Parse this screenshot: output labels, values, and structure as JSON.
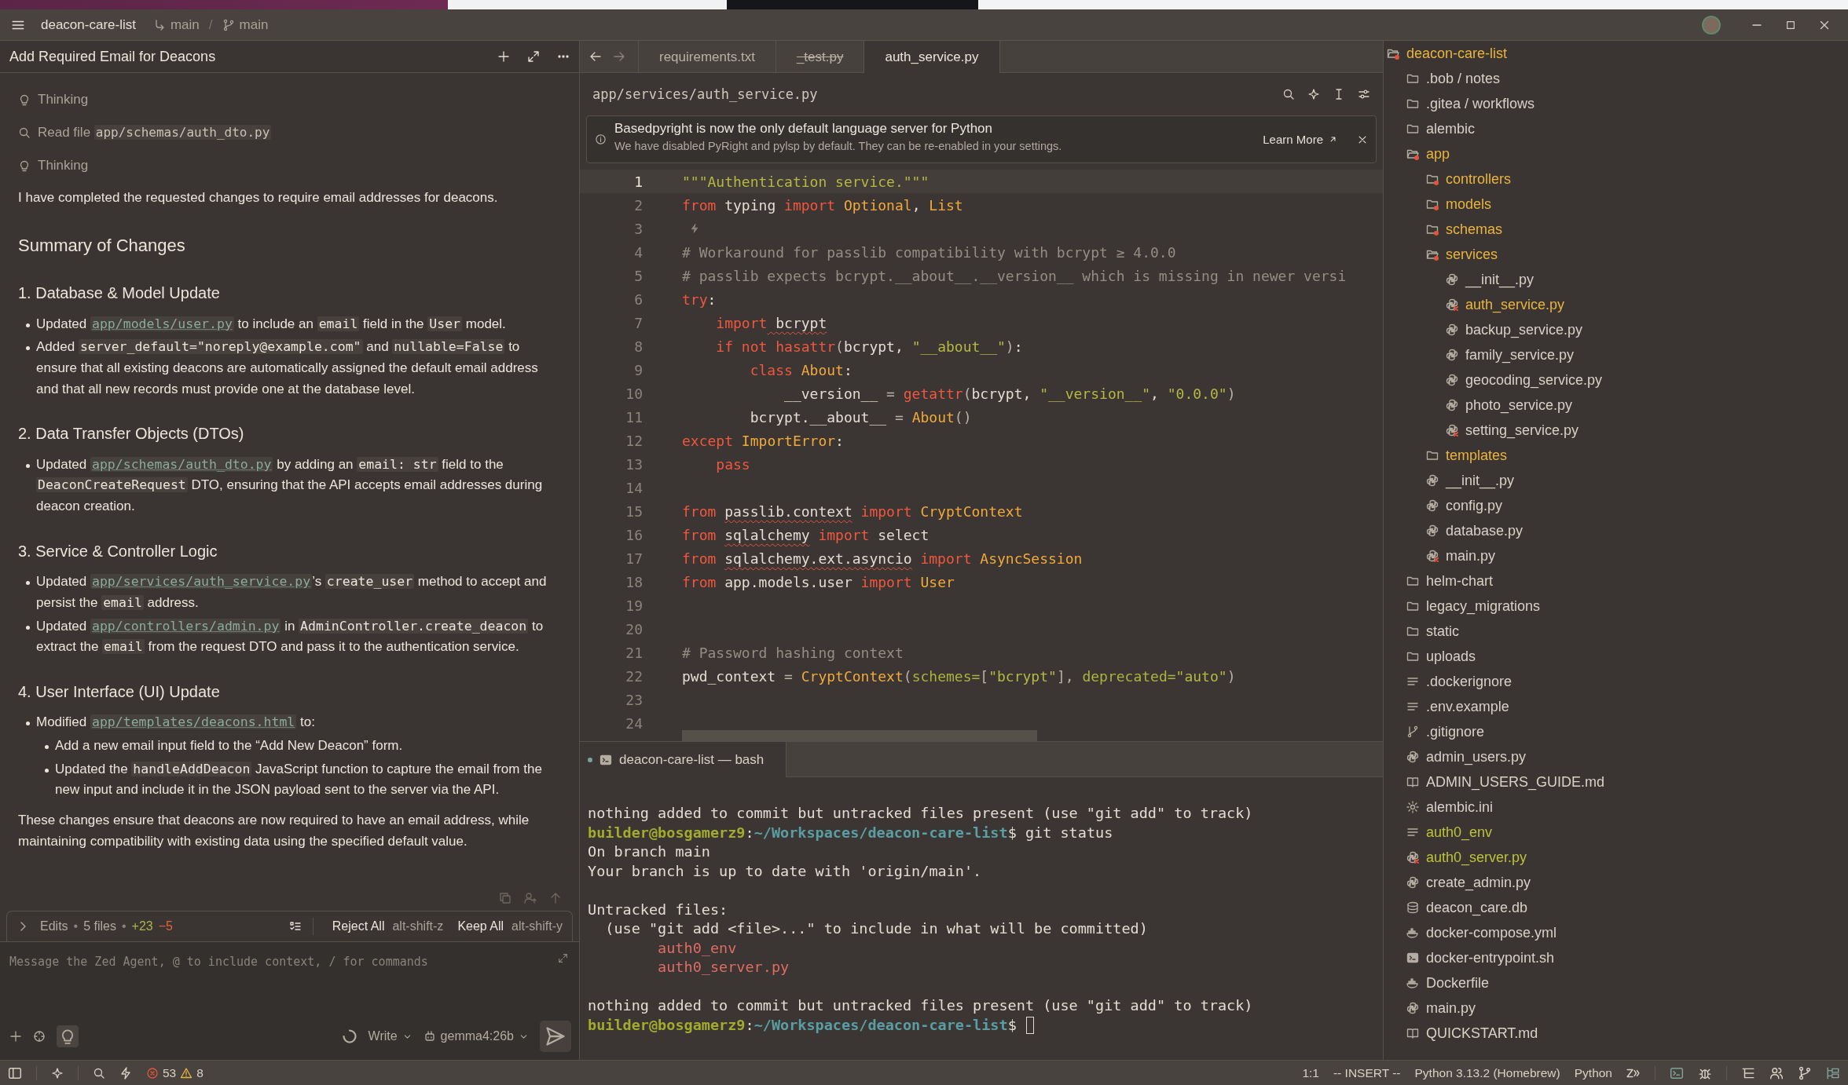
{
  "title_bar": {
    "project": "deacon-care-list",
    "worktree": "main",
    "separator": "/",
    "branch": "main"
  },
  "agent_panel": {
    "title": "Add Required Email for Deacons",
    "activity": [
      {
        "kind": "thinking",
        "label": "Thinking"
      },
      {
        "kind": "read",
        "label": "Read file ",
        "path": "app/schemas/auth_dto.py"
      },
      {
        "kind": "thinking",
        "label": "Thinking"
      }
    ],
    "message": [
      {
        "kind": "paragraph",
        "segments": [
          {
            "kind": "text",
            "text": "I have completed the requested changes to require email addresses for deacons."
          }
        ]
      },
      {
        "kind": "heading",
        "text": "Summary of Changes"
      },
      {
        "kind": "subheading",
        "text": "1. Database & Model Update"
      },
      {
        "kind": "bullets",
        "items": [
          {
            "segments": [
              {
                "kind": "text",
                "text": "Updated "
              },
              {
                "kind": "link",
                "text": "app/models/user.py"
              },
              {
                "kind": "text",
                "text": " to include an "
              },
              {
                "kind": "code",
                "text": "email"
              },
              {
                "kind": "text",
                "text": " field in the "
              },
              {
                "kind": "code",
                "text": "User"
              },
              {
                "kind": "text",
                "text": " model."
              }
            ]
          },
          {
            "segments": [
              {
                "kind": "text",
                "text": "Added "
              },
              {
                "kind": "code",
                "text": "server_default=\"noreply@example.com\""
              },
              {
                "kind": "text",
                "text": " and "
              },
              {
                "kind": "code",
                "text": "nullable=False"
              },
              {
                "kind": "text",
                "text": " to ensure that all existing deacons are automatically assigned the default email address and that all new records must provide one at the database level."
              }
            ]
          }
        ]
      },
      {
        "kind": "subheading",
        "text": "2. Data Transfer Objects (DTOs)"
      },
      {
        "kind": "bullets",
        "items": [
          {
            "segments": [
              {
                "kind": "text",
                "text": "Updated "
              },
              {
                "kind": "link",
                "text": "app/schemas/auth_dto.py"
              },
              {
                "kind": "text",
                "text": " by adding an "
              },
              {
                "kind": "code",
                "text": "email: str"
              },
              {
                "kind": "text",
                "text": " field to the "
              },
              {
                "kind": "code",
                "text": "DeaconCreateRequest"
              },
              {
                "kind": "text",
                "text": " DTO, ensuring that the API accepts email addresses during deacon creation."
              }
            ]
          }
        ]
      },
      {
        "kind": "subheading",
        "text": "3. Service & Controller Logic"
      },
      {
        "kind": "bullets",
        "items": [
          {
            "segments": [
              {
                "kind": "text",
                "text": "Updated "
              },
              {
                "kind": "link",
                "text": "app/services/auth_service.py"
              },
              {
                "kind": "text",
                "text": "’s "
              },
              {
                "kind": "code",
                "text": "create_user"
              },
              {
                "kind": "text",
                "text": " method to accept and persist the "
              },
              {
                "kind": "code",
                "text": "email"
              },
              {
                "kind": "text",
                "text": " address."
              }
            ]
          },
          {
            "segments": [
              {
                "kind": "text",
                "text": "Updated "
              },
              {
                "kind": "link",
                "text": "app/controllers/admin.py"
              },
              {
                "kind": "text",
                "text": " in "
              },
              {
                "kind": "code",
                "text": "AdminController.create_deacon"
              },
              {
                "kind": "text",
                "text": " to extract the "
              },
              {
                "kind": "code",
                "text": "email"
              },
              {
                "kind": "text",
                "text": " from the request DTO and pass it to the authentication service."
              }
            ]
          }
        ]
      },
      {
        "kind": "subheading",
        "text": "4. User Interface (UI) Update"
      },
      {
        "kind": "bullets",
        "items": [
          {
            "segments": [
              {
                "kind": "text",
                "text": "Modified "
              },
              {
                "kind": "link",
                "text": "app/templates/deacons.html"
              },
              {
                "kind": "text",
                "text": " to:"
              }
            ],
            "children": [
              {
                "segments": [
                  {
                    "kind": "text",
                    "text": "Add a new email input field to the “Add New Deacon” form."
                  }
                ]
              },
              {
                "segments": [
                  {
                    "kind": "text",
                    "text": "Updated the "
                  },
                  {
                    "kind": "code",
                    "text": "handleAddDeacon"
                  },
                  {
                    "kind": "text",
                    "text": " JavaScript function to capture the email from the new input and include it in the JSON payload sent to the server via the API."
                  }
                ]
              }
            ]
          }
        ]
      },
      {
        "kind": "paragraph",
        "segments": [
          {
            "kind": "text",
            "text": "These changes ensure that deacons are now required to have an email address, while maintaining compatibility with existing data using the specified default value."
          }
        ]
      }
    ],
    "edits": {
      "expanded": false,
      "summary": [
        {
          "kind": "label",
          "text": "Edits"
        },
        {
          "kind": "sep",
          "text": "•"
        },
        {
          "kind": "label",
          "text": "5 files"
        },
        {
          "kind": "sep",
          "text": "•"
        },
        {
          "kind": "added",
          "text": "+23"
        },
        {
          "kind": "removed",
          "text": "−5"
        }
      ],
      "reject": {
        "label": "Reject All",
        "shortcut": "alt-shift-z"
      },
      "keep": {
        "label": "Keep All",
        "shortcut": "alt-shift-y"
      }
    },
    "input": {
      "placeholder": "Message the Zed Agent, @ to include context, / for commands"
    },
    "generating": true,
    "mode": "Write",
    "model": "gemma4:26b"
  },
  "editor": {
    "tabs": [
      {
        "label": "requirements.txt",
        "selected": false,
        "deleted": false
      },
      {
        "label": "_test.py",
        "selected": false,
        "deleted": true
      },
      {
        "label": "auth_service.py",
        "selected": true,
        "deleted": false
      }
    ],
    "path": "app/services/auth_service.py",
    "notice": {
      "title": "Basedpyright is now the only default language server for Python",
      "body": "We have disabled PyRight and pylsp by default. They can be re-enabled in your settings.",
      "action": "Learn More"
    },
    "lines": [
      {
        "n": "1",
        "active": true,
        "tokens": [
          {
            "kind": "str",
            "text": "\"\"\"Authentication service.\"\"\""
          }
        ]
      },
      {
        "n": "2",
        "active": false,
        "tokens": [
          {
            "kind": "kw",
            "text": "from"
          },
          {
            "kind": "plain",
            "text": " typing "
          },
          {
            "kind": "kw",
            "text": "import"
          },
          {
            "kind": "type",
            "text": " Optional"
          },
          {
            "kind": "plain",
            "text": ", "
          },
          {
            "kind": "type",
            "text": "List"
          }
        ]
      },
      {
        "n": "3",
        "active": false,
        "kind": "prediction"
      },
      {
        "n": "4",
        "active": false,
        "tokens": [
          {
            "kind": "cm",
            "text": "# Workaround for passlib compatibility with bcrypt ≥ 4.0.0"
          }
        ]
      },
      {
        "n": "5",
        "active": false,
        "tokens": [
          {
            "kind": "cm",
            "text": "# passlib expects bcrypt.__about__.__version__ which is missing in newer versi"
          }
        ]
      },
      {
        "n": "6",
        "active": false,
        "tokens": [
          {
            "kind": "kw",
            "text": "try"
          },
          {
            "kind": "plain",
            "text": ":"
          }
        ]
      },
      {
        "n": "7",
        "active": false,
        "tokens": [
          {
            "kind": "kw",
            "text": "    import"
          },
          {
            "kind": "bad",
            "text": " bcrypt"
          }
        ]
      },
      {
        "n": "8",
        "active": false,
        "tokens": [
          {
            "kind": "kw",
            "text": "    if not hasattr"
          },
          {
            "kind": "punct",
            "text": "("
          },
          {
            "kind": "plain",
            "text": "bcrypt, "
          },
          {
            "kind": "str",
            "text": "\"__about__\""
          },
          {
            "kind": "punct",
            "text": ")"
          },
          {
            "kind": "plain",
            "text": ":"
          }
        ]
      },
      {
        "n": "9",
        "active": false,
        "tokens": [
          {
            "kind": "kw",
            "text": "        class"
          },
          {
            "kind": "type",
            "text": " About"
          },
          {
            "kind": "plain",
            "text": ":"
          }
        ]
      },
      {
        "n": "10",
        "active": false,
        "tokens": [
          {
            "kind": "plain",
            "text": "            __version__ "
          },
          {
            "kind": "punct",
            "text": "= "
          },
          {
            "kind": "kw",
            "text": "getattr"
          },
          {
            "kind": "punct",
            "text": "("
          },
          {
            "kind": "plain",
            "text": "bcrypt, "
          },
          {
            "kind": "str",
            "text": "\"__version__\""
          },
          {
            "kind": "plain",
            "text": ", "
          },
          {
            "kind": "str",
            "text": "\"0.0.0\""
          },
          {
            "kind": "punct",
            "text": ")"
          }
        ]
      },
      {
        "n": "11",
        "active": false,
        "tokens": [
          {
            "kind": "plain",
            "text": "        bcrypt.__about__ "
          },
          {
            "kind": "punct",
            "text": "= "
          },
          {
            "kind": "type",
            "text": "About"
          },
          {
            "kind": "punct",
            "text": "()"
          }
        ]
      },
      {
        "n": "12",
        "active": false,
        "tokens": [
          {
            "kind": "kw",
            "text": "except"
          },
          {
            "kind": "type",
            "text": " ImportError"
          },
          {
            "kind": "plain",
            "text": ":"
          }
        ]
      },
      {
        "n": "13",
        "active": false,
        "tokens": [
          {
            "kind": "kw",
            "text": "    pass"
          }
        ]
      },
      {
        "n": "14",
        "active": false
      },
      {
        "n": "15",
        "active": false,
        "tokens": [
          {
            "kind": "kw",
            "text": "from "
          },
          {
            "kind": "bad",
            "text": "passlib.context"
          },
          {
            "kind": "kw",
            "text": " import"
          },
          {
            "kind": "type",
            "text": " CryptContext"
          }
        ]
      },
      {
        "n": "16",
        "active": false,
        "tokens": [
          {
            "kind": "kw",
            "text": "from "
          },
          {
            "kind": "bad",
            "text": "sqlalchemy"
          },
          {
            "kind": "kw",
            "text": " import"
          },
          {
            "kind": "plain",
            "text": " select"
          }
        ]
      },
      {
        "n": "17",
        "active": false,
        "tokens": [
          {
            "kind": "kw",
            "text": "from "
          },
          {
            "kind": "bad",
            "text": "sqlalchemy.ext.asyncio"
          },
          {
            "kind": "kw",
            "text": " import"
          },
          {
            "kind": "type",
            "text": " AsyncSession"
          }
        ]
      },
      {
        "n": "18",
        "active": false,
        "tokens": [
          {
            "kind": "kw",
            "text": "from"
          },
          {
            "kind": "plain",
            "text": " app.models.user "
          },
          {
            "kind": "kw",
            "text": "import"
          },
          {
            "kind": "type",
            "text": " User"
          }
        ]
      },
      {
        "n": "19",
        "active": false
      },
      {
        "n": "20",
        "active": false
      },
      {
        "n": "21",
        "active": false,
        "tokens": [
          {
            "kind": "cm",
            "text": "# Password hashing context"
          }
        ]
      },
      {
        "n": "22",
        "active": false,
        "tokens": [
          {
            "kind": "plain",
            "text": "pwd_context "
          },
          {
            "kind": "punct",
            "text": "= "
          },
          {
            "kind": "type",
            "text": "CryptContext"
          },
          {
            "kind": "punct",
            "text": "("
          },
          {
            "kind": "param",
            "text": "schemes="
          },
          {
            "kind": "punct",
            "text": "["
          },
          {
            "kind": "str",
            "text": "\"bcrypt\""
          },
          {
            "kind": "punct",
            "text": "], "
          },
          {
            "kind": "param",
            "text": "deprecated="
          },
          {
            "kind": "str",
            "text": "\"auto\""
          },
          {
            "kind": "punct",
            "text": ")"
          }
        ]
      },
      {
        "n": "23",
        "active": false
      },
      {
        "n": "24",
        "active": false
      }
    ]
  },
  "terminal": {
    "tab": {
      "label": "deacon-care-list — bash",
      "selected": true
    },
    "cursor": true,
    "lines": [
      {
        "kind": "text",
        "segments": [
          {
            "kind": "plain",
            "text": "nothing added to commit but untracked files present (use \"git add\" to track)"
          }
        ]
      },
      {
        "kind": "text",
        "segments": [
          {
            "kind": "user",
            "text": "builder@bosgamerz9"
          },
          {
            "kind": "plain",
            "text": ":"
          },
          {
            "kind": "path",
            "text": "~/Workspaces/deacon-care-list"
          },
          {
            "kind": "plain",
            "text": "$ git status"
          }
        ]
      },
      {
        "kind": "text",
        "segments": [
          {
            "kind": "plain",
            "text": "On branch main"
          }
        ]
      },
      {
        "kind": "text",
        "segments": [
          {
            "kind": "plain",
            "text": "Your branch is up to date with 'origin/main'."
          }
        ]
      },
      {
        "kind": "blank"
      },
      {
        "kind": "text",
        "segments": [
          {
            "kind": "plain",
            "text": "Untracked files:"
          }
        ]
      },
      {
        "kind": "text",
        "segments": [
          {
            "kind": "plain",
            "text": "  (use \"git add <file>...\" to include in what will be committed)"
          }
        ]
      },
      {
        "kind": "text",
        "segments": [
          {
            "kind": "untracked",
            "text": "auth0_env"
          }
        ]
      },
      {
        "kind": "text",
        "segments": [
          {
            "kind": "untracked",
            "text": "auth0_server.py"
          }
        ]
      },
      {
        "kind": "blank"
      },
      {
        "kind": "text",
        "segments": [
          {
            "kind": "plain",
            "text": "nothing added to commit but untracked files present (use \"git add\" to track)"
          }
        ]
      },
      {
        "kind": "prompt",
        "segments": [
          {
            "kind": "user",
            "text": "builder@bosgamerz9"
          },
          {
            "kind": "plain",
            "text": ":"
          },
          {
            "kind": "path",
            "text": "~/Workspaces/deacon-care-list"
          },
          {
            "kind": "plain",
            "text": "$"
          }
        ]
      }
    ]
  },
  "project_tree": {
    "items": [
      {
        "name": "deacon-care-list",
        "kind": "folder",
        "expanded": true,
        "modified": true,
        "untracked": false,
        "has_errors": true,
        "children": [
          {
            "name": ".bob / notes",
            "kind": "folder",
            "expanded": false,
            "modified": false,
            "untracked": false,
            "has_errors": false
          },
          {
            "name": ".gitea / workflows",
            "kind": "folder",
            "expanded": false,
            "modified": false,
            "untracked": false,
            "has_errors": false
          },
          {
            "name": "alembic",
            "kind": "folder",
            "expanded": false,
            "modified": false,
            "untracked": false,
            "has_errors": false
          },
          {
            "name": "app",
            "kind": "folder",
            "expanded": true,
            "modified": true,
            "untracked": false,
            "has_errors": true,
            "children": [
              {
                "name": "controllers",
                "kind": "folder",
                "expanded": false,
                "modified": true,
                "untracked": false,
                "has_errors": true
              },
              {
                "name": "models",
                "kind": "folder",
                "expanded": false,
                "modified": true,
                "untracked": false,
                "has_errors": true
              },
              {
                "name": "schemas",
                "kind": "folder",
                "expanded": false,
                "modified": true,
                "untracked": false,
                "has_errors": true
              },
              {
                "name": "services",
                "kind": "folder",
                "expanded": true,
                "modified": true,
                "untracked": false,
                "has_errors": true,
                "children": [
                  {
                    "name": "__init__.py",
                    "kind": "python",
                    "modified": false,
                    "untracked": false,
                    "has_errors": false
                  },
                  {
                    "name": "auth_service.py",
                    "kind": "python",
                    "modified": true,
                    "untracked": false,
                    "has_errors": true
                  },
                  {
                    "name": "backup_service.py",
                    "kind": "python",
                    "modified": false,
                    "untracked": false,
                    "has_errors": false
                  },
                  {
                    "name": "family_service.py",
                    "kind": "python",
                    "modified": false,
                    "untracked": false,
                    "has_errors": false
                  },
                  {
                    "name": "geocoding_service.py",
                    "kind": "python",
                    "modified": false,
                    "untracked": false,
                    "has_errors": false
                  },
                  {
                    "name": "photo_service.py",
                    "kind": "python",
                    "modified": false,
                    "untracked": false,
                    "has_errors": false
                  },
                  {
                    "name": "setting_service.py",
                    "kind": "python",
                    "modified": false,
                    "untracked": false,
                    "has_errors": true
                  }
                ]
              },
              {
                "name": "templates",
                "kind": "folder",
                "expanded": false,
                "modified": true,
                "untracked": false,
                "has_errors": false
              },
              {
                "name": "__init__.py",
                "kind": "python",
                "modified": false,
                "untracked": false,
                "has_errors": false
              },
              {
                "name": "config.py",
                "kind": "python",
                "modified": false,
                "untracked": false,
                "has_errors": false
              },
              {
                "name": "database.py",
                "kind": "python",
                "modified": false,
                "untracked": false,
                "has_errors": false
              },
              {
                "name": "main.py",
                "kind": "python",
                "modified": false,
                "untracked": false,
                "has_errors": true
              }
            ]
          },
          {
            "name": "helm-chart",
            "kind": "folder",
            "expanded": false,
            "modified": false,
            "untracked": false,
            "has_errors": false
          },
          {
            "name": "legacy_migrations",
            "kind": "folder",
            "expanded": false,
            "modified": false,
            "untracked": false,
            "has_errors": false
          },
          {
            "name": "static",
            "kind": "folder",
            "expanded": false,
            "modified": false,
            "untracked": false,
            "has_errors": false
          },
          {
            "name": "uploads",
            "kind": "folder",
            "expanded": false,
            "modified": false,
            "untracked": false,
            "has_errors": false
          },
          {
            "name": ".dockerignore",
            "kind": "text",
            "modified": false,
            "untracked": false,
            "has_errors": false
          },
          {
            "name": ".env.example",
            "kind": "text",
            "modified": false,
            "untracked": false,
            "has_errors": false
          },
          {
            "name": ".gitignore",
            "kind": "git",
            "modified": false,
            "untracked": false,
            "has_errors": false
          },
          {
            "name": "admin_users.py",
            "kind": "python",
            "modified": false,
            "untracked": false,
            "has_errors": false
          },
          {
            "name": "ADMIN_USERS_GUIDE.md",
            "kind": "markdown",
            "modified": false,
            "untracked": false,
            "has_errors": false
          },
          {
            "name": "alembic.ini",
            "kind": "config",
            "modified": false,
            "untracked": false,
            "has_errors": false
          },
          {
            "name": "auth0_env",
            "kind": "text",
            "modified": false,
            "untracked": true,
            "has_errors": false
          },
          {
            "name": "auth0_server.py",
            "kind": "python",
            "modified": false,
            "untracked": true,
            "has_errors": true
          },
          {
            "name": "create_admin.py",
            "kind": "python",
            "modified": false,
            "untracked": false,
            "has_errors": false
          },
          {
            "name": "deacon_care.db",
            "kind": "database",
            "modified": false,
            "untracked": false,
            "has_errors": false
          },
          {
            "name": "docker-compose.yml",
            "kind": "docker",
            "modified": false,
            "untracked": false,
            "has_errors": false
          },
          {
            "name": "docker-entrypoint.sh",
            "kind": "shell",
            "modified": false,
            "untracked": false,
            "has_errors": false
          },
          {
            "name": "Dockerfile",
            "kind": "docker",
            "modified": false,
            "untracked": false,
            "has_errors": false
          },
          {
            "name": "main.py",
            "kind": "python",
            "modified": false,
            "untracked": false,
            "has_errors": false
          },
          {
            "name": "QUICKSTART.md",
            "kind": "markdown",
            "modified": false,
            "untracked": false,
            "has_errors": false
          }
        ]
      }
    ]
  },
  "status_bar": {
    "errors": "53",
    "warnings": "8",
    "position": "1:1",
    "mode": "-- INSERT --",
    "interpreter": "Python 3.13.2 (Homebrew)",
    "language": "Python"
  }
}
